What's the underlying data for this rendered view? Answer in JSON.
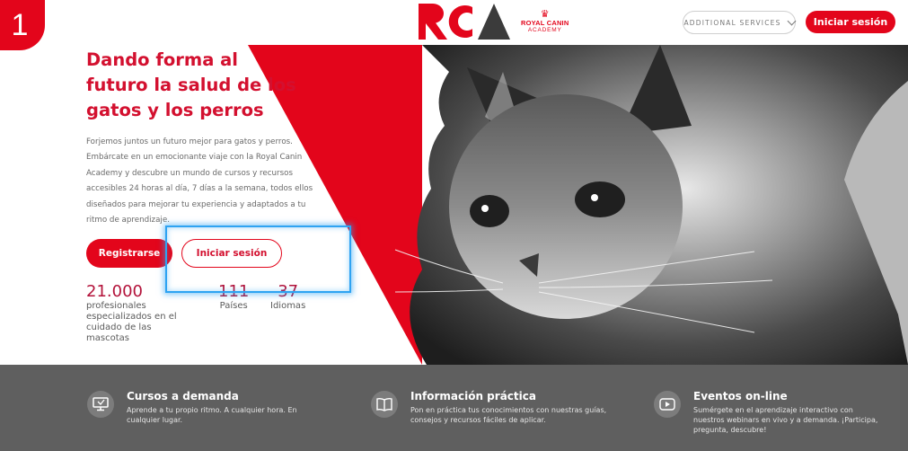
{
  "step_number": "1",
  "header": {
    "logo_text": "RCA",
    "brand_name": "ROYAL CANIN",
    "brand_sub": "ACADEMY",
    "services_label": "ADDITIONAL SERVICES",
    "login_label": "Iniciar sesión"
  },
  "hero": {
    "title": "Dando forma al futuro la salud de los gatos y los perros",
    "description": "Forjemos juntos un futuro mejor para gatos y perros. Embárcate en un emocionante viaje con la Royal Canin Academy y descubre un mundo de cursos y recursos accesibles 24 horas al día, 7 días a la semana, todos ellos diseñados para mejorar tu experiencia y adaptados a tu ritmo de aprendizaje.",
    "register_label": "Registrarse",
    "login_label": "Iniciar sesión",
    "stats": [
      {
        "value": "21.000",
        "label": "profesionales especializados en el cuidado de las mascotas"
      },
      {
        "value": "111",
        "label": "Países"
      },
      {
        "value": "37",
        "label": "Idiomas"
      }
    ]
  },
  "features": [
    {
      "icon": "monitor-icon",
      "title": "Cursos a demanda",
      "description": "Aprende a tu propio ritmo. A cualquier hora. En cualquier lugar."
    },
    {
      "icon": "book-icon",
      "title": "Información práctica",
      "description": "Pon en práctica tus conocimientos con nuestras guías, consejos y recursos fáciles de aplicar."
    },
    {
      "icon": "play-icon",
      "title": "Eventos on-line",
      "description": "Sumérgete en el aprendizaje interactivo con nuestros webinars en vivo y a demanda. ¡Participa, pregunta, descubre!"
    }
  ],
  "colors": {
    "brand_red": "#e3051b",
    "title_red": "#d3102f",
    "highlight_blue": "#2ea3f2",
    "footer_gray": "#5f5f5f"
  }
}
